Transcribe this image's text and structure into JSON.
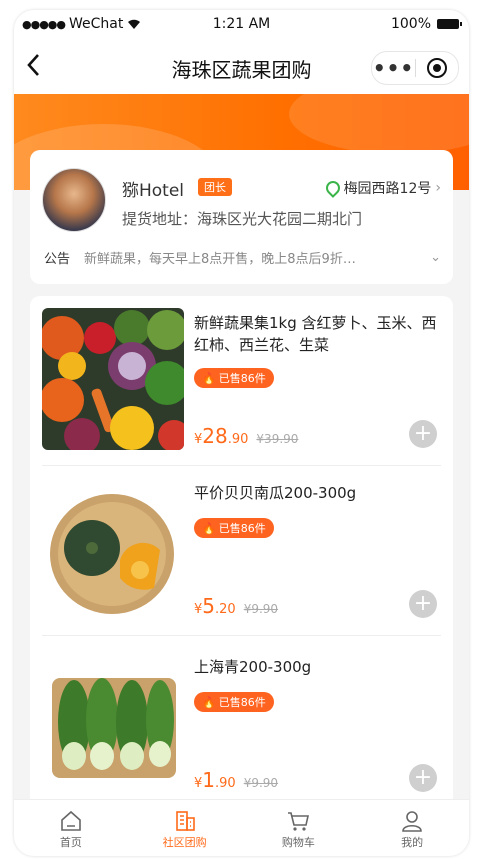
{
  "status_bar": {
    "carrier": "WeChat",
    "time": "1:21 AM",
    "battery": "100%"
  },
  "nav": {
    "back_icon": "chevron-left-icon",
    "title": "海珠区蔬果团购"
  },
  "leader": {
    "name": "猕Hotel",
    "badge": "团长",
    "location": "梅园西路12号",
    "pickup": "提货地址：海珠区光大花园二期北门",
    "notice_label": "公告",
    "notice_text": "新鲜蔬果，每天早上8点开售，晚上8点后9折…"
  },
  "products": [
    {
      "title": "新鲜蔬果集1kg 含红萝卜、玉米、西红柿、西兰花、生菜",
      "sold": "已售86件",
      "currency": "¥",
      "price_int": "28",
      "price_dec": ".90",
      "old_price": "¥39.90"
    },
    {
      "title": "平价贝贝南瓜200-300g",
      "sold": "已售86件",
      "currency": "¥",
      "price_int": "5",
      "price_dec": ".20",
      "old_price": "¥9.90"
    },
    {
      "title": "上海青200-300g",
      "sold": "已售86件",
      "currency": "¥",
      "price_int": "1",
      "price_dec": ".90",
      "old_price": "¥9.90"
    }
  ],
  "tabs": [
    {
      "label": "首页",
      "icon": "home-icon"
    },
    {
      "label": "社区团购",
      "icon": "building-icon",
      "active": true
    },
    {
      "label": "购物车",
      "icon": "cart-icon"
    },
    {
      "label": "我的",
      "icon": "user-icon"
    }
  ],
  "colors": {
    "accent": "#ff6a1a",
    "banner": "#ff7a0e",
    "location_pin": "#3bb54a"
  }
}
